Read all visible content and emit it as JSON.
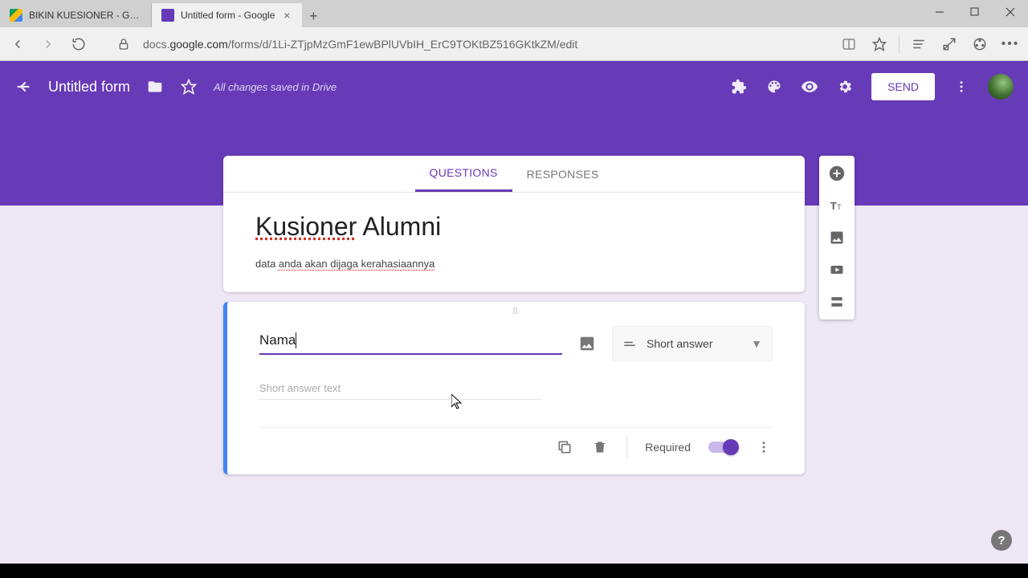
{
  "browser": {
    "tabs": [
      {
        "title": "BIKIN KUESIONER - Google"
      },
      {
        "title": "Untitled form - Google"
      }
    ],
    "url_prefix": "docs.",
    "url_host": "google.com",
    "url_path": "/forms/d/1Li-ZTjpMzGmF1ewBPlUVbIH_ErC9TOKtBZ516GKtkZM/edit"
  },
  "header": {
    "back": "←",
    "title": "Untitled form",
    "saved": "All changes saved in Drive",
    "send": "SEND"
  },
  "tabs": {
    "questions": "QUESTIONS",
    "responses": "RESPONSES"
  },
  "form": {
    "title_word1": "Kusioner",
    "title_word2": " Alumni",
    "desc_prefix": "data ",
    "desc_spell": "anda akan dijaga kerahasiaannya"
  },
  "question": {
    "title": "Nama",
    "type": "Short answer",
    "placeholder": "Short answer text",
    "required_label": "Required"
  },
  "colors": {
    "primary": "#673ab7"
  }
}
